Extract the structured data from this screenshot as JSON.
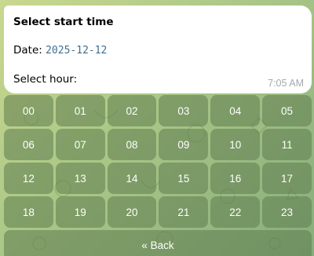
{
  "message": {
    "title": "Select start time",
    "date_label": "Date: ",
    "date_value": "2025-12-12",
    "hour_label": "Select hour:",
    "time": "7:05 AM"
  },
  "keyboard": {
    "hours": [
      "00",
      "01",
      "02",
      "03",
      "04",
      "05",
      "06",
      "07",
      "08",
      "09",
      "10",
      "11",
      "12",
      "13",
      "14",
      "15",
      "16",
      "17",
      "18",
      "19",
      "20",
      "21",
      "22",
      "23"
    ],
    "back_label": "« Back"
  }
}
